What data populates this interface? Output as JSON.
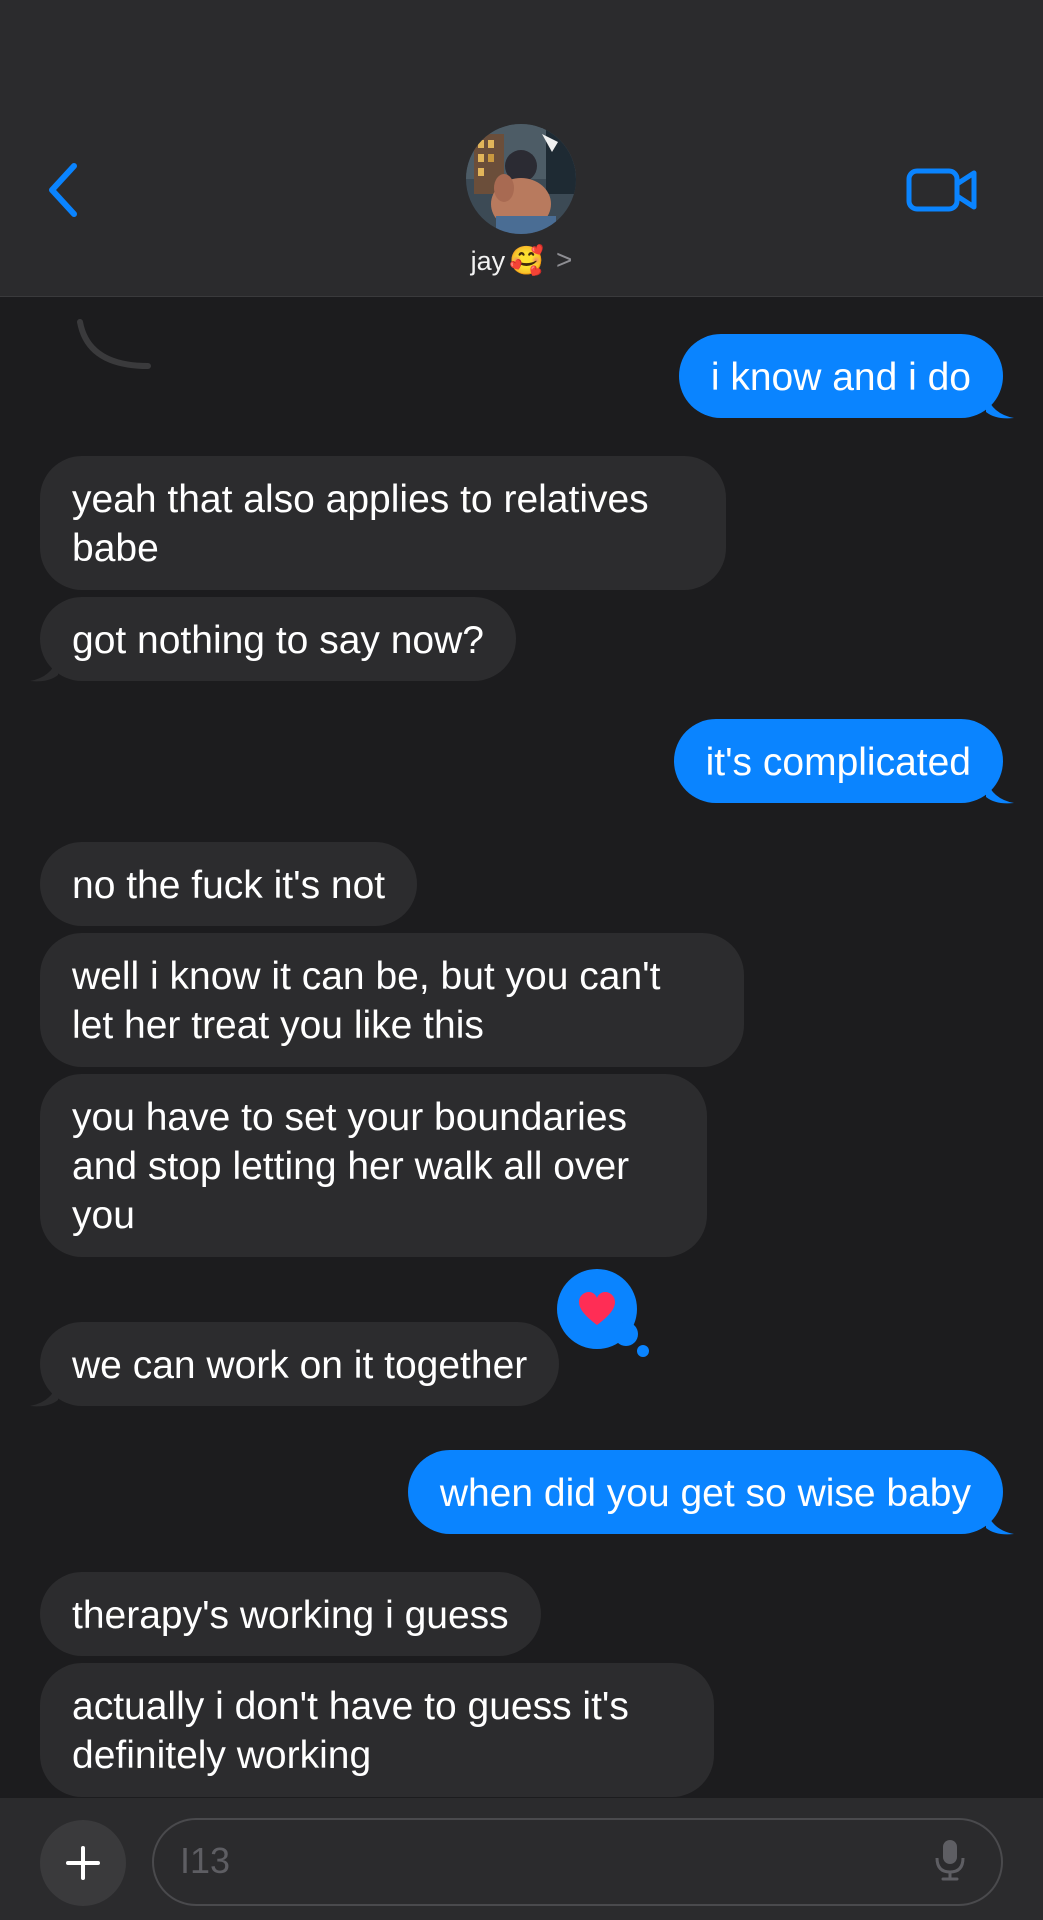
{
  "contact": {
    "name": "jay",
    "emoji": "🥰",
    "chevron": ">"
  },
  "messages": [
    {
      "direction": "out",
      "lines": [
        "i know and i do"
      ]
    },
    {
      "direction": "in",
      "lines": [
        "yeah that also applies to relatives",
        "babe"
      ]
    },
    {
      "direction": "in",
      "lines": [
        "got nothing to say now?"
      ]
    },
    {
      "direction": "out",
      "lines": [
        "it's complicated"
      ]
    },
    {
      "direction": "in",
      "lines": [
        "no the fuck it's not"
      ]
    },
    {
      "direction": "in",
      "lines": [
        "well i know it can be, but you can't",
        "let her treat you like this"
      ]
    },
    {
      "direction": "in",
      "lines": [
        "you have to set your boundaries",
        "and stop letting her walk all over",
        "you"
      ]
    },
    {
      "direction": "in",
      "lines": [
        "we can work on it together"
      ],
      "reaction": "heart-icon"
    },
    {
      "direction": "out",
      "lines": [
        "when did you get so wise baby"
      ]
    },
    {
      "direction": "in",
      "lines": [
        "therapy's working i guess"
      ]
    },
    {
      "direction": "in",
      "lines": [
        "actually i don't have to guess it's",
        "definitely working"
      ]
    }
  ],
  "composer": {
    "placeholder": "I13"
  },
  "colors": {
    "accent": "#0a84ff",
    "incoming_bubble": "#2c2c2e",
    "background": "#1c1c1e",
    "heart": "#ff2d55"
  }
}
